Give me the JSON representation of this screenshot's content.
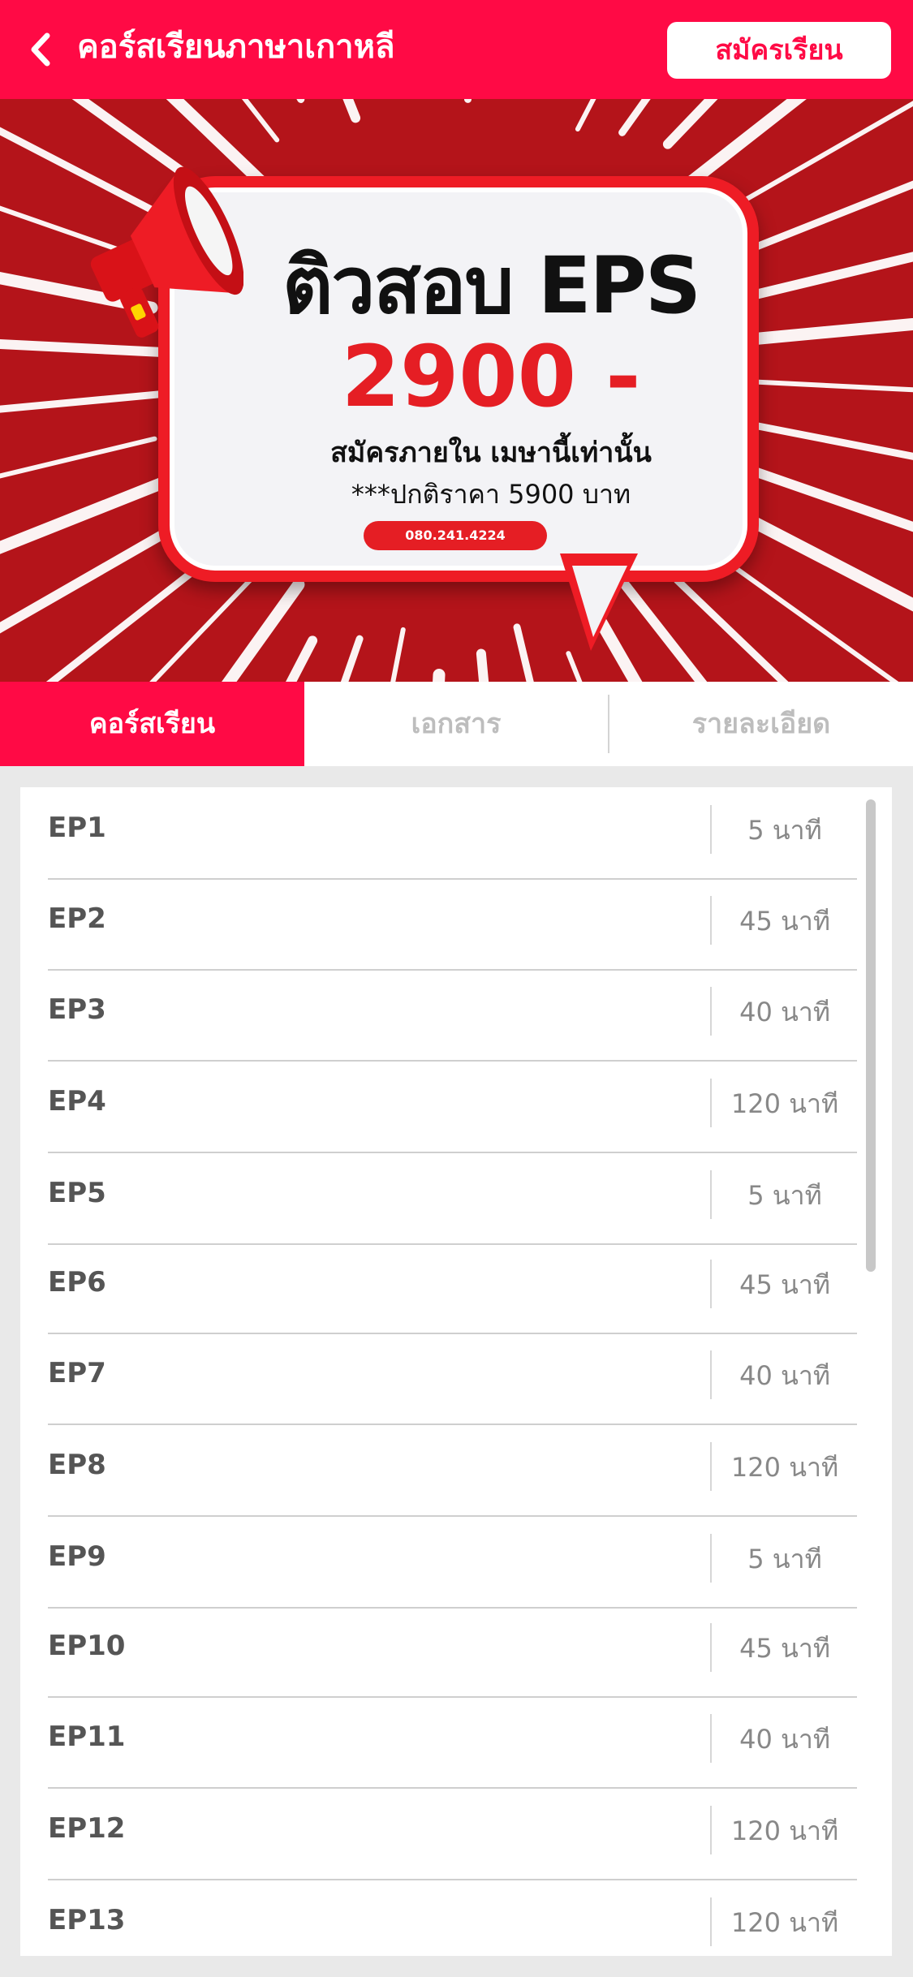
{
  "header": {
    "title": "คอร์สเรียนภาษาเกาหลี",
    "register_label": "สมัครเรียน"
  },
  "banner": {
    "title": "ติวสอบ EPS",
    "price": "2900 -",
    "subtitle": "สมัครภายใน เมษานี้เท่านั้น",
    "normal_price": "***ปกติราคา 5900 บาท",
    "phone": "080.241.4224"
  },
  "tabs": [
    {
      "label": "คอร์สเรียน",
      "active": true
    },
    {
      "label": "เอกสาร",
      "active": false
    },
    {
      "label": "รายละเอียด",
      "active": false
    }
  ],
  "episodes": [
    {
      "label": "EP1",
      "duration": "5 นาที"
    },
    {
      "label": "EP2",
      "duration": "45 นาที"
    },
    {
      "label": "EP3",
      "duration": "40 นาที"
    },
    {
      "label": "EP4",
      "duration": "120 นาที"
    },
    {
      "label": "EP5",
      "duration": "5 นาที"
    },
    {
      "label": "EP6",
      "duration": "45 นาที"
    },
    {
      "label": "EP7",
      "duration": "40 นาที"
    },
    {
      "label": "EP8",
      "duration": "120 นาที"
    },
    {
      "label": "EP9",
      "duration": "5 นาที"
    },
    {
      "label": "EP10",
      "duration": "45 นาที"
    },
    {
      "label": "EP11",
      "duration": "40 นาที"
    },
    {
      "label": "EP12",
      "duration": "120 นาที"
    },
    {
      "label": "EP13",
      "duration": "120 นาที"
    }
  ],
  "icons": {
    "back": "chevron-left-icon",
    "megaphone": "megaphone-icon"
  },
  "colors": {
    "brand": "#ff0a45",
    "banner_red": "#b4141a",
    "price_red": "#e51e24"
  }
}
